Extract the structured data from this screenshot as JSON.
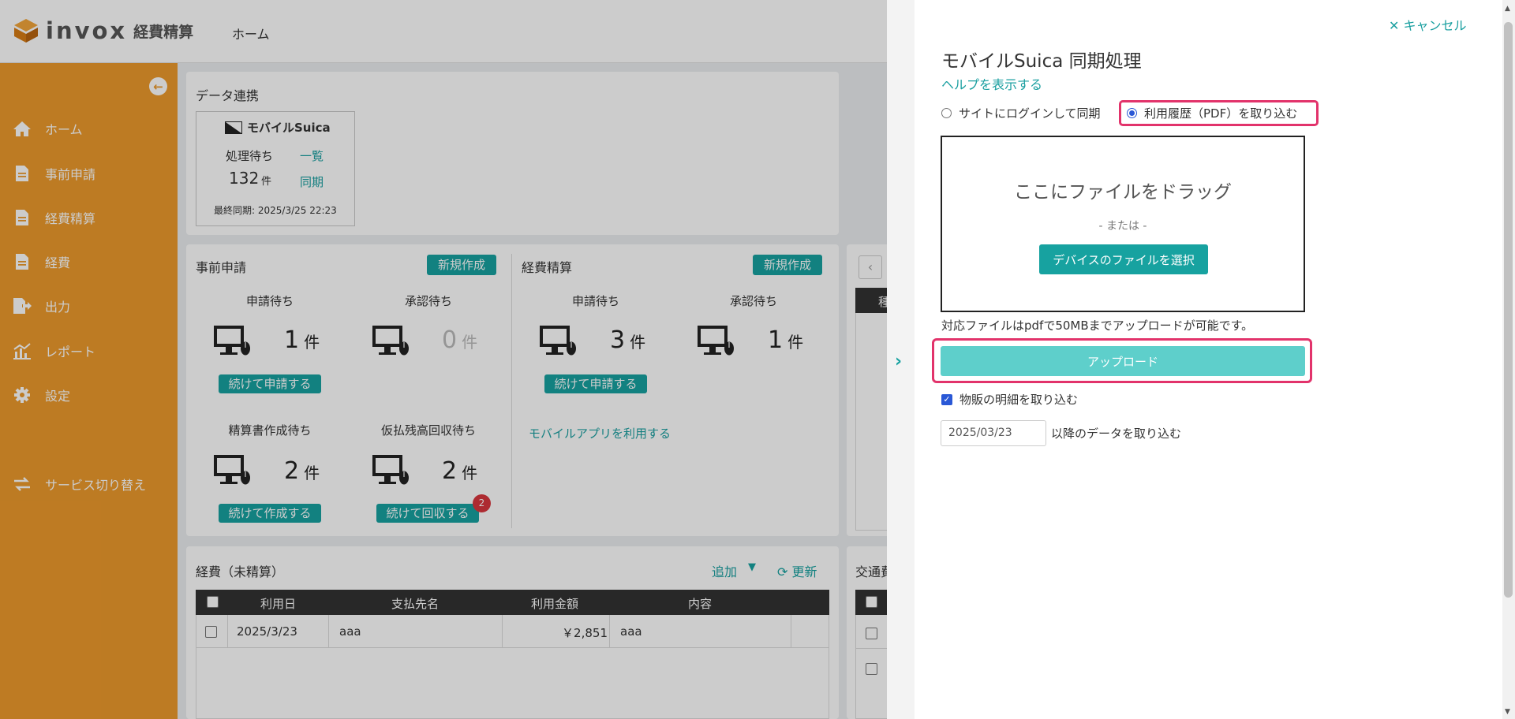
{
  "header": {
    "logo_text": "invox",
    "logo_sub": "経費精算",
    "home_link": "ホーム"
  },
  "sidebar": {
    "items": [
      {
        "label": "ホーム",
        "icon": "home-icon"
      },
      {
        "label": "事前申請",
        "icon": "document-icon"
      },
      {
        "label": "経費精算",
        "icon": "document-icon"
      },
      {
        "label": "経費",
        "icon": "document-icon"
      },
      {
        "label": "出力",
        "icon": "export-icon"
      },
      {
        "label": "レポート",
        "icon": "chart-icon"
      },
      {
        "label": "設定",
        "icon": "gear-icon"
      },
      {
        "label": "サービス切り替え",
        "icon": "switch-icon"
      }
    ]
  },
  "data_link": {
    "title": "データ連携",
    "suica_title": "モバイルSuica",
    "pending_label": "処理待ち",
    "pending_count": "132",
    "pending_unit": "件",
    "list_link": "一覧",
    "sync_link": "同期",
    "last_sync": "最終同期: 2025/3/25 22:23"
  },
  "pre_application": {
    "title": "事前申請",
    "new_button": "新規作成",
    "stats": [
      {
        "label": "申請待ち",
        "count": "1",
        "unit": "件",
        "action": "続けて申請する"
      },
      {
        "label": "承認待ち",
        "count": "0",
        "unit": "件",
        "action": ""
      },
      {
        "label": "精算書作成待ち",
        "count": "2",
        "unit": "件",
        "action": "続けて作成する"
      },
      {
        "label": "仮払残高回収待ち",
        "count": "2",
        "unit": "件",
        "action": "続けて回収する",
        "badge": "2"
      }
    ]
  },
  "expense_settlement": {
    "title": "経費精算",
    "new_button": "新規作成",
    "stats": [
      {
        "label": "申請待ち",
        "count": "3",
        "unit": "件",
        "action": "続けて申請する"
      },
      {
        "label": "承認待ち",
        "count": "1",
        "unit": "件",
        "action": ""
      }
    ],
    "mobile_link": "モバイルアプリを利用する"
  },
  "third_card": {
    "header_partial": "種"
  },
  "unsettled": {
    "title": "経費（未精算）",
    "add_label": "追加",
    "refresh_label": "更新",
    "columns": [
      "利用日",
      "支払先名",
      "利用金額",
      "内容"
    ],
    "rows": [
      {
        "date": "2025/3/23",
        "payee": "aaa",
        "amount": "￥2,851",
        "content": "aaa"
      }
    ]
  },
  "transport": {
    "title_partial": "交通費"
  },
  "panel": {
    "cancel": "キャンセル",
    "title": "モバイルSuica 同期処理",
    "help": "ヘルプを表示する",
    "radio_login": "サイトにログインして同期",
    "radio_pdf": "利用履歴（PDF）を取り込む",
    "selected_mode": "pdf",
    "drop_main": "ここにファイルをドラッグ",
    "drop_or": "- または -",
    "choose_file": "デバイスのファイルを選択",
    "note": "対応ファイルはpdfで50MBまでアップロードが可能です。",
    "upload": "アップロード",
    "checkbox_label": "物販の明細を取り込む",
    "checkbox_checked": true,
    "date_value": "2025/03/23",
    "date_suffix": "以降のデータを取り込む"
  },
  "colors": {
    "sidebar": "#ed9a2c",
    "accent": "#17a2a0",
    "highlight": "#e2336b",
    "upload_button": "#5ecfcb"
  }
}
